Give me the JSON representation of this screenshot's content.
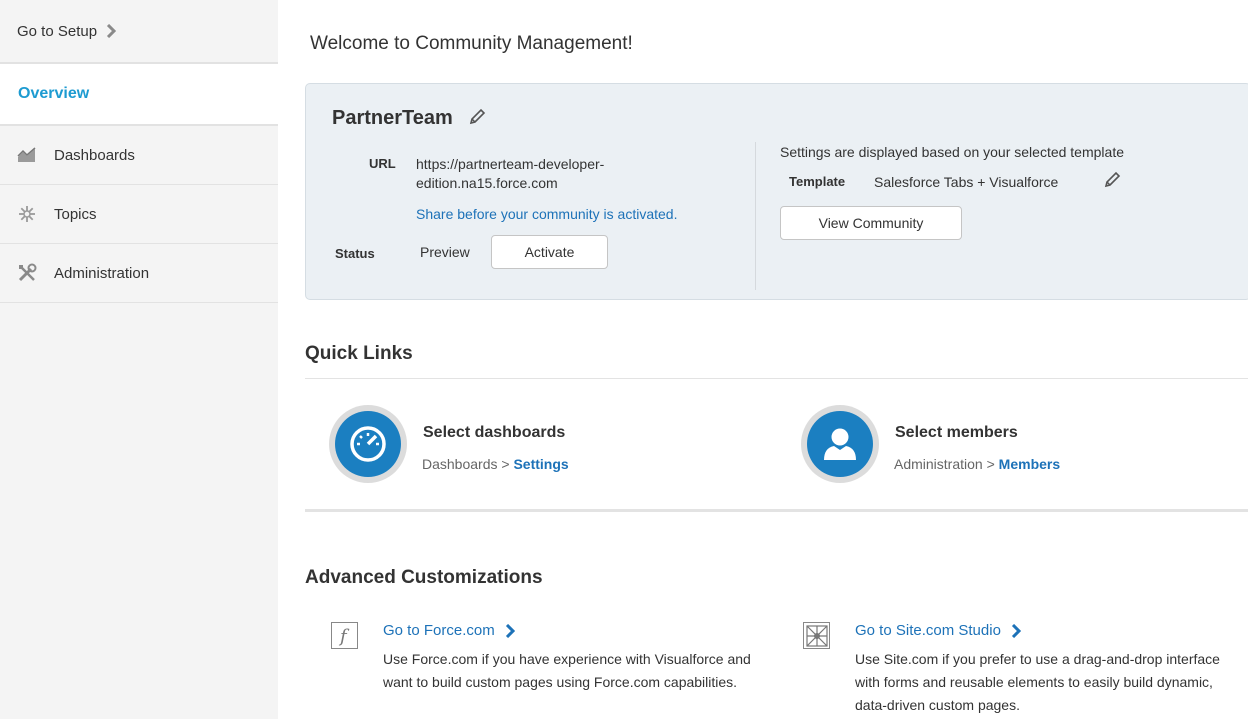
{
  "sidebar": {
    "setup_label": "Go to Setup",
    "overview_label": "Overview",
    "items": [
      {
        "label": "Dashboards",
        "icon": "dashboards-icon"
      },
      {
        "label": "Topics",
        "icon": "topics-icon"
      },
      {
        "label": "Administration",
        "icon": "administration-icon"
      }
    ]
  },
  "main": {
    "welcome": "Welcome to Community Management!",
    "community": {
      "name": "PartnerTeam",
      "url_label": "URL",
      "url_line1": "https://partnerteam-developer-",
      "url_line2": "edition.na15.force.com",
      "share_link": "Share before your community is activated.",
      "status_label": "Status",
      "status_value": "Preview",
      "activate_label": "Activate",
      "settings_note": "Settings are displayed based on your selected template",
      "template_label": "Template",
      "template_value": "Salesforce Tabs + Visualforce",
      "view_label": "View Community"
    },
    "quick_links": {
      "heading": "Quick Links",
      "items": [
        {
          "title": "Select dashboards",
          "path": "Dashboards >",
          "link": "Settings"
        },
        {
          "title": "Select members",
          "path": "Administration >",
          "link": "Members"
        }
      ]
    },
    "advanced": {
      "heading": "Advanced Customizations",
      "items": [
        {
          "title": "Go to Force.com",
          "desc": "Use Force.com if you have experience with Visualforce and want to build custom pages using Force.com capabilities."
        },
        {
          "title": "Go to Site.com Studio",
          "desc": "Use Site.com if you prefer to use a drag-and-drop interface with forms and reusable elements to easily build dynamic, data-driven custom pages."
        }
      ]
    }
  },
  "colors": {
    "accent": "#1d9bd1",
    "link": "#1d72b8",
    "icon_blue": "#1b7fc1",
    "card_bg": "#ebf0f4"
  }
}
